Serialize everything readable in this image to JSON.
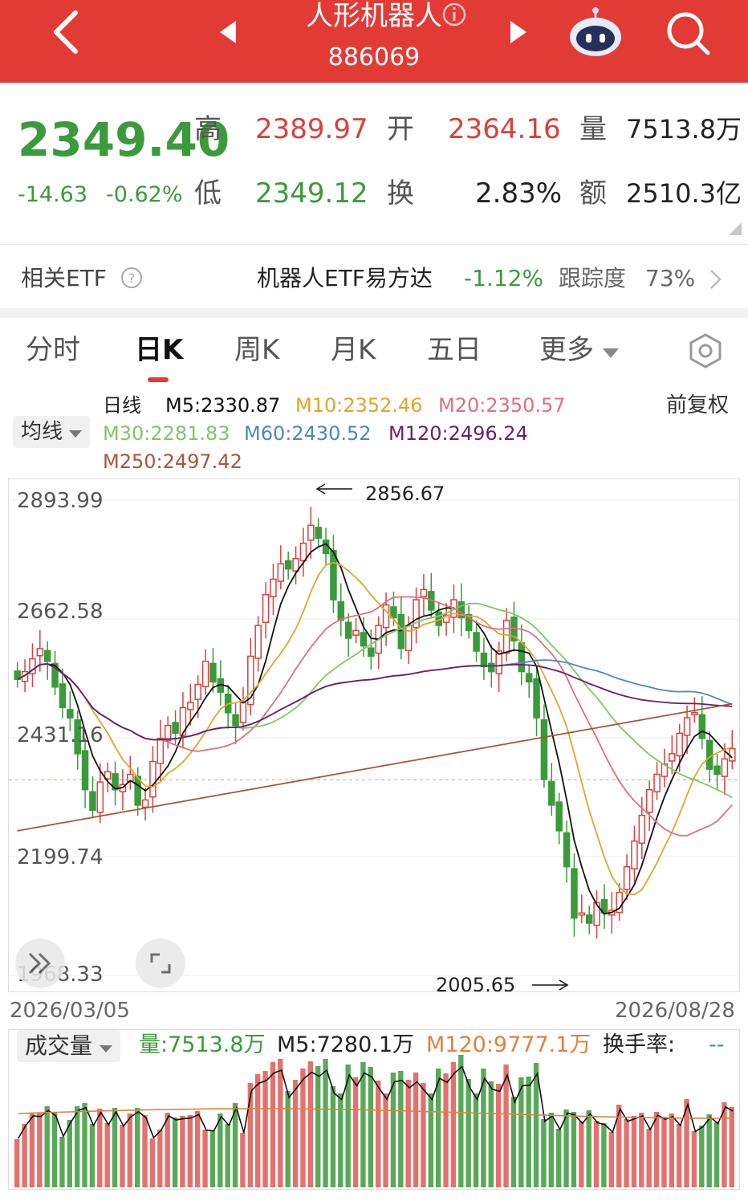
{
  "header": {
    "title": "人形机器人",
    "code": "886069"
  },
  "quote": {
    "price": "2349.40",
    "change": "-14.63",
    "change_pct": "-0.62%",
    "high_label": "高",
    "high": "2389.97",
    "low_label": "低",
    "low": "2349.12",
    "open_label": "开",
    "open": "2364.16",
    "turnover_label": "换",
    "turnover": "2.83%",
    "volume_label": "量",
    "volume": "7513.8万",
    "amount_label": "额",
    "amount": "2510.3亿"
  },
  "etf": {
    "label": "相关ETF",
    "name": "机器人ETF易方达",
    "change": "-1.12%",
    "tracking_label": "跟踪度",
    "tracking": "73%"
  },
  "tabs": [
    {
      "label": "分时"
    },
    {
      "label": "日K"
    },
    {
      "label": "周K"
    },
    {
      "label": "月K"
    },
    {
      "label": "五日"
    },
    {
      "label": "更多"
    }
  ],
  "ma_panel": {
    "type_label": "日线",
    "selector": "均线",
    "adjust": "前复权",
    "m5": "M5:2330.87",
    "m10": "M10:2352.46",
    "m20": "M20:2350.57",
    "m30": "M30:2281.83",
    "m60": "M60:2430.52",
    "m120": "M120:2496.24",
    "m250": "M250:2497.42"
  },
  "colors": {
    "header_bg": "#e23b36",
    "up": "#d9413c",
    "down": "#3b9a3b",
    "m5": "#111111",
    "m10": "#e0a52b",
    "m20": "#e0707a",
    "m30": "#7dc766",
    "m60": "#4a88c0",
    "m120": "#6b1f6b",
    "m250": "#a9553a"
  },
  "chart_data": {
    "type": "candlestick",
    "y_ticks": [
      "2893.99",
      "2662.58",
      "2431.16",
      "2199.74",
      "1968.33"
    ],
    "ylim": [
      1968.33,
      2893.99
    ],
    "x_start": "2026/03/05",
    "x_end": "2026/08/28",
    "annotations": [
      {
        "text": "2856.67",
        "kind": "high"
      },
      {
        "text": "2005.65",
        "kind": "low"
      }
    ],
    "close": [
      2545,
      2560,
      2585,
      2605,
      2580,
      2530,
      2490,
      2470,
      2400,
      2330,
      2290,
      2345,
      2365,
      2330,
      2340,
      2360,
      2300,
      2310,
      2385,
      2430,
      2455,
      2440,
      2490,
      2500,
      2535,
      2580,
      2540,
      2520,
      2480,
      2455,
      2500,
      2590,
      2650,
      2710,
      2740,
      2770,
      2760,
      2780,
      2810,
      2845,
      2820,
      2790,
      2700,
      2660,
      2625,
      2640,
      2610,
      2590,
      2650,
      2690,
      2665,
      2605,
      2650,
      2700,
      2720,
      2680,
      2650,
      2670,
      2700,
      2665,
      2640,
      2600,
      2570,
      2560,
      2600,
      2660,
      2620,
      2560,
      2540,
      2470,
      2350,
      2300,
      2250,
      2180,
      2080,
      2090,
      2070,
      2110,
      2090,
      2095,
      2130,
      2180,
      2230,
      2280,
      2330,
      2360,
      2380,
      2400,
      2440,
      2470,
      2480,
      2430,
      2370,
      2360,
      2390,
      2410
    ],
    "ma_last": {
      "M5": 2330.87,
      "M10": 2352.46,
      "M20": 2350.57,
      "M30": 2281.83,
      "M60": 2430.52,
      "M120": 2496.24,
      "M250": 2497.42
    }
  },
  "volume_panel": {
    "selector": "成交量",
    "vol": "量:7513.8万",
    "m5": "M5:7280.1万",
    "m120": "M120:9777.1万",
    "turnover": "换手率:",
    "turnover_value": "--"
  }
}
